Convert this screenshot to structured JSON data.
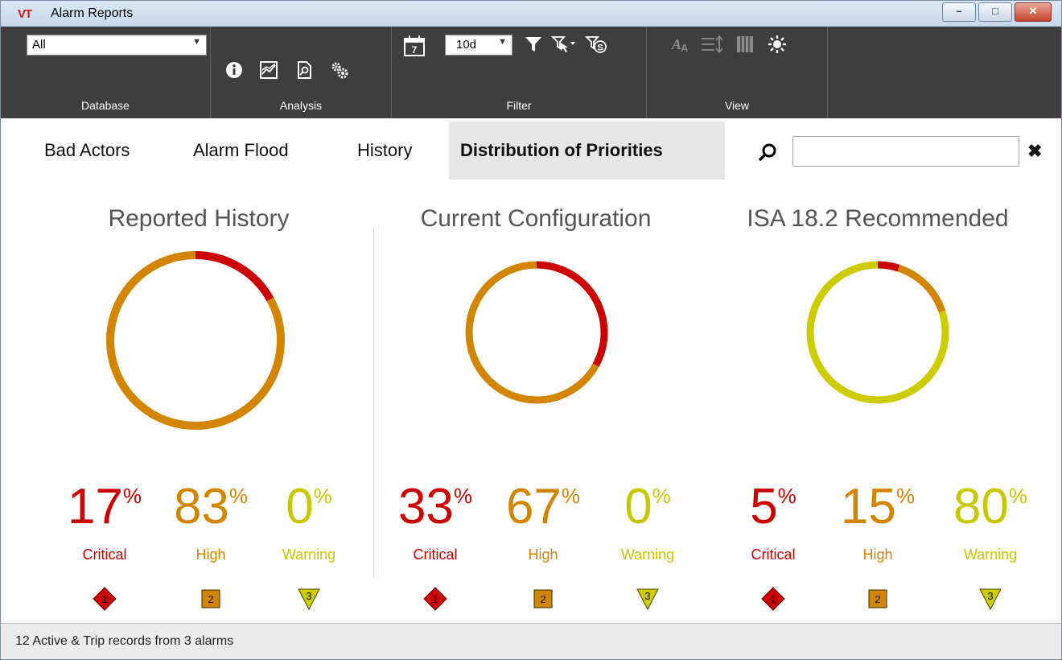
{
  "window": {
    "logo": "VT",
    "title": "Alarm Reports",
    "buttons": {
      "minimize": "–",
      "restore": "□",
      "close": "✕"
    }
  },
  "toolbar": {
    "database": {
      "selected": "All",
      "label": "Database"
    },
    "analysis": {
      "label": "Analysis",
      "icons": [
        "info-icon",
        "trend-chart-icon",
        "report-search-icon",
        "settings-gears-icon"
      ]
    },
    "filter": {
      "label": "Filter",
      "range": "10d",
      "icons": [
        "calendar-icon",
        "filter-icon",
        "filter-select-icon",
        "filter-s-icon"
      ]
    },
    "view": {
      "label": "View",
      "icons": [
        "font-size-icon",
        "row-height-icon",
        "columns-icon",
        "brightness-icon"
      ]
    }
  },
  "tabs": [
    {
      "label": "Bad Actors",
      "active": false
    },
    {
      "label": "Alarm Flood",
      "active": false
    },
    {
      "label": "History",
      "active": false
    },
    {
      "label": "Distribution of Priorities",
      "active": true
    }
  ],
  "search": {
    "value": "",
    "placeholder": "",
    "clear": "✖"
  },
  "colors": {
    "critical": "#cc0000",
    "high": "#d48500",
    "warning": "#cccc00"
  },
  "panels": [
    {
      "title": "Reported History",
      "stats": [
        {
          "name": "Critical",
          "value": 17,
          "value_text": "17",
          "unit": "%",
          "marker": "1"
        },
        {
          "name": "High",
          "value": 83,
          "value_text": "83",
          "unit": "%",
          "marker": "2"
        },
        {
          "name": "Warning",
          "value": 0,
          "value_text": "0",
          "unit": "%",
          "marker": "3"
        }
      ]
    },
    {
      "title": "Current Configuration",
      "stats": [
        {
          "name": "Critical",
          "value": 33,
          "value_text": "33",
          "unit": "%",
          "marker": "1"
        },
        {
          "name": "High",
          "value": 67,
          "value_text": "67",
          "unit": "%",
          "marker": "2"
        },
        {
          "name": "Warning",
          "value": 0,
          "value_text": "0",
          "unit": "%",
          "marker": "3"
        }
      ]
    },
    {
      "title": "ISA 18.2 Recommended",
      "stats": [
        {
          "name": "Critical",
          "value": 5,
          "value_text": "5",
          "unit": "%",
          "marker": "1"
        },
        {
          "name": "High",
          "value": 15,
          "value_text": "15",
          "unit": "%",
          "marker": "2"
        },
        {
          "name": "Warning",
          "value": 80,
          "value_text": "80",
          "unit": "%",
          "marker": "3"
        }
      ]
    }
  ],
  "status": {
    "text": "12 Active & Trip records from 3 alarms"
  }
}
